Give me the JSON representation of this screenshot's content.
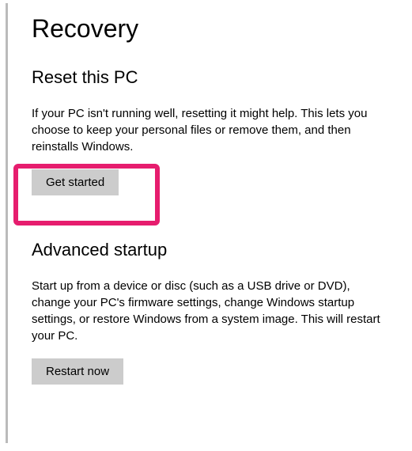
{
  "page": {
    "title": "Recovery"
  },
  "reset_pc": {
    "title": "Reset this PC",
    "description": "If your PC isn't running well, resetting it might help. This lets you choose to keep your personal files or remove them, and then reinstalls Windows.",
    "button_label": "Get started"
  },
  "advanced_startup": {
    "title": "Advanced startup",
    "description": "Start up from a device or disc (such as a USB drive or DVD), change your PC's firmware settings, change Windows startup settings, or restore Windows from a system image. This will restart your PC.",
    "button_label": "Restart now"
  }
}
